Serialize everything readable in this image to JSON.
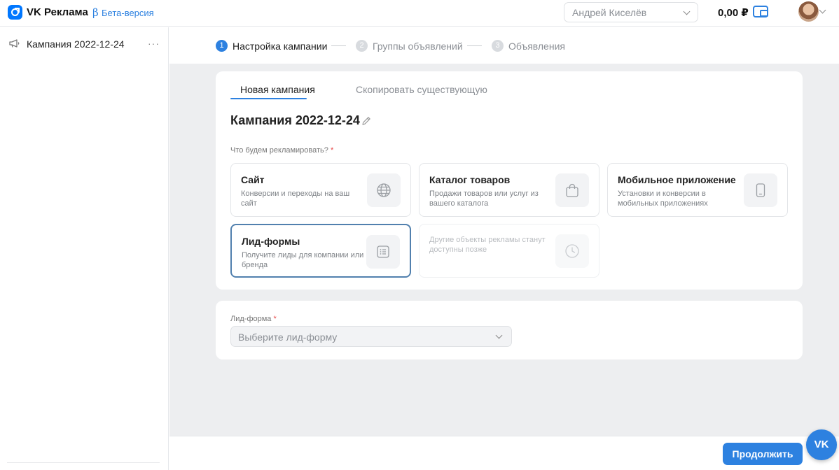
{
  "header": {
    "brand": "VK Реклама",
    "beta_symbol": "β",
    "beta_label": "Бета-версия",
    "account_name": "Андрей Киселёв",
    "balance": "0,00 ₽"
  },
  "sidebar": {
    "items": [
      {
        "label": "Кампания 2022-12-24",
        "menu": "···"
      }
    ]
  },
  "stepper": {
    "steps": [
      {
        "num": "1",
        "label": "Настройка кампании",
        "state": "active"
      },
      {
        "num": "2",
        "label": "Группы объявлений",
        "state": "inactive"
      },
      {
        "num": "3",
        "label": "Объявления",
        "state": "inactive"
      }
    ]
  },
  "campaign": {
    "tabs": [
      {
        "label": "Новая кампания",
        "active": true
      },
      {
        "label": "Скопировать существующую",
        "active": false
      }
    ],
    "title": "Кампания 2022-12-24",
    "question": "Что будем рекламировать?",
    "required_mark": "*",
    "options": [
      {
        "title": "Сайт",
        "desc": "Конверсии и переходы на ваш сайт",
        "icon": "globe-icon",
        "selected": false
      },
      {
        "title": "Каталог товаров",
        "desc": "Продажи товаров или услуг из вашего каталога",
        "icon": "shopping-bag-icon",
        "selected": false
      },
      {
        "title": "Мобильное приложение",
        "desc": "Установки и конверсии в мобильных приложениях",
        "icon": "smartphone-icon",
        "selected": false
      },
      {
        "title": "Лид-формы",
        "desc": "Получите лиды для компании или бренда",
        "icon": "form-list-icon",
        "selected": true
      },
      {
        "title": "",
        "desc": "Другие объекты рекламы станут доступны позже",
        "icon": "clock-icon",
        "disabled": true
      }
    ]
  },
  "lead_form": {
    "label": "Лид-форма",
    "required_mark": "*",
    "placeholder": "Выберите лид-форму"
  },
  "footer": {
    "continue_label": "Продолжить",
    "chat_label": "VK"
  },
  "colors": {
    "accent": "#2d81e0",
    "selected_border": "#5180ae",
    "background": "#edeef0"
  }
}
